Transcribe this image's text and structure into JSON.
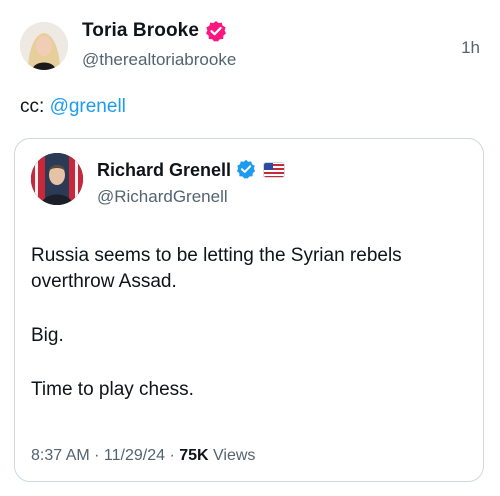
{
  "post": {
    "author_name": "Toria Brooke",
    "author_handle": "@therealtoriabrooke",
    "time": "1h",
    "text_prefix": "cc: ",
    "mention": "@grenell",
    "badge_color": "#f91880"
  },
  "quoted": {
    "author_name": "Richard Grenell",
    "author_handle": "@RichardGrenell",
    "badge_color": "#1d9bf0",
    "affiliation_badge_icon": "flag-affiliation-icon",
    "paragraphs": [
      "Russia seems to be letting the Syrian rebels overthrow Assad.",
      "Big.",
      "Time to play chess."
    ],
    "timestamp": "8:37 AM · 11/29/24 · ",
    "views_count": "75K",
    "views_label": " Views"
  },
  "colors": {
    "link": "#1d9bf0",
    "secondary_text": "#536471",
    "border": "#cfd9de"
  }
}
